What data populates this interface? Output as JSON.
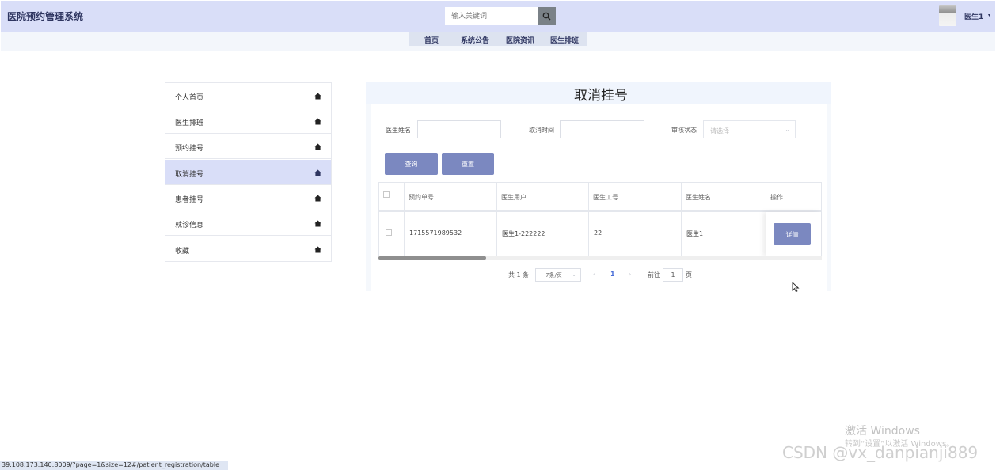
{
  "header": {
    "title": "医院预约管理系统",
    "search_placeholder": "输入关键词",
    "user_name": "医生1",
    "user_caret": "▾"
  },
  "nav": {
    "items": [
      "首页",
      "系统公告",
      "医院资讯",
      "医生排班"
    ]
  },
  "sidebar": {
    "items": [
      {
        "label": "个人首页",
        "icon": "home-icon"
      },
      {
        "label": "医生排班",
        "icon": "home-icon"
      },
      {
        "label": "预约挂号",
        "icon": "home-icon"
      },
      {
        "label": "取消挂号",
        "icon": "home-icon",
        "active": true
      },
      {
        "label": "患者挂号",
        "icon": "home-icon"
      },
      {
        "label": "就诊信息",
        "icon": "home-icon"
      },
      {
        "label": "收藏",
        "icon": "home-icon"
      }
    ]
  },
  "page": {
    "title": "取消挂号"
  },
  "filters": {
    "doctor_name_label": "医生姓名",
    "cancel_time_label": "取消时间",
    "review_status_label": "审核状态",
    "review_status_placeholder": "请选择",
    "query_button": "查询",
    "reset_button": "重置"
  },
  "table": {
    "columns": [
      "预约单号",
      "医生用户",
      "医生工号",
      "医生姓名",
      "操作"
    ],
    "rows": [
      {
        "order_no": "1715571989532",
        "doctor_user": "医生1-222222",
        "doctor_id": "22",
        "doctor_name": "医生1",
        "action": "详情"
      }
    ]
  },
  "pagination": {
    "total": "共 1 条",
    "page_size": "7条/页",
    "prev": "‹",
    "current_page": "1",
    "next": "›",
    "goto_prefix": "前往",
    "goto_value": "1",
    "goto_suffix": "页"
  },
  "status_bar": {
    "url": "39.108.173.140:8009/?page=1&size=12#/patient_registration/table"
  },
  "watermark": {
    "activate_line1": "激活 Windows",
    "activate_line2": "转到“设置”以激活 Windows。",
    "csdn": "CSDN @vx_danpianji889"
  }
}
